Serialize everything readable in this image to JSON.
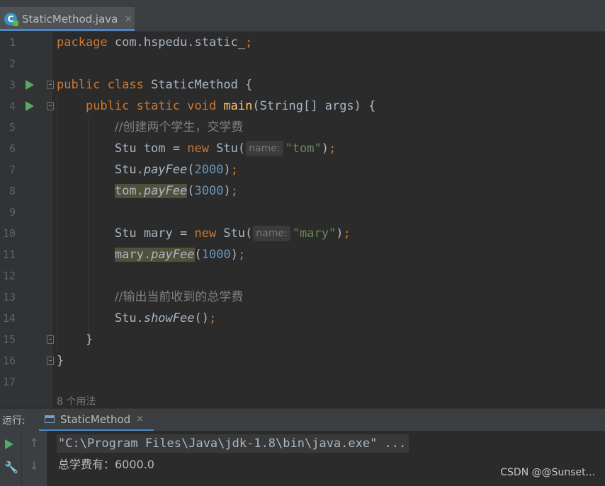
{
  "editor_tab": {
    "icon": "java-class-icon",
    "label": "StaticMethod.java",
    "close": "×"
  },
  "lines": [
    {
      "n": "1",
      "tokens": [
        [
          "kw",
          "package "
        ],
        [
          "plain",
          "com.hspedu.static_"
        ],
        [
          "kw",
          ";"
        ]
      ]
    },
    {
      "n": "2",
      "tokens": []
    },
    {
      "n": "3",
      "tokens": [
        [
          "kw",
          "public class "
        ],
        [
          "plain",
          "StaticMethod {"
        ]
      ]
    },
    {
      "n": "4",
      "tokens": [
        [
          "plain",
          "    "
        ],
        [
          "kw",
          "public static void "
        ],
        [
          "fn",
          "main"
        ],
        [
          "plain",
          "(String[] args) {"
        ]
      ]
    },
    {
      "n": "5",
      "tokens": [
        [
          "plain",
          "        "
        ],
        [
          "cmt",
          "//创建两个学生，交学费"
        ]
      ]
    },
    {
      "n": "6",
      "tokens": [
        [
          "plain",
          "        Stu tom = "
        ],
        [
          "kw",
          "new "
        ],
        [
          "plain",
          "Stu("
        ],
        [
          "hint",
          "name:"
        ],
        [
          "str",
          "\"tom\""
        ],
        [
          "plain",
          ")"
        ],
        [
          "kw",
          ";"
        ]
      ]
    },
    {
      "n": "7",
      "tokens": [
        [
          "plain",
          "        Stu."
        ],
        [
          "it",
          "payFee"
        ],
        [
          "plain",
          "("
        ],
        [
          "num",
          "2000"
        ],
        [
          "plain",
          ")"
        ],
        [
          "kw",
          ";"
        ]
      ]
    },
    {
      "n": "8",
      "tokens": [
        [
          "plain",
          "        "
        ],
        [
          "hl",
          "tom."
        ],
        [
          "hlit",
          "payFee"
        ],
        [
          "plain",
          "("
        ],
        [
          "num",
          "3000"
        ],
        [
          "plain",
          ")"
        ],
        [
          "kw",
          ";"
        ]
      ]
    },
    {
      "n": "9",
      "tokens": []
    },
    {
      "n": "10",
      "tokens": [
        [
          "plain",
          "        Stu mary = "
        ],
        [
          "kw",
          "new "
        ],
        [
          "plain",
          "Stu("
        ],
        [
          "hint",
          "name:"
        ],
        [
          "str",
          "\"mary\""
        ],
        [
          "plain",
          ")"
        ],
        [
          "kw",
          ";"
        ]
      ]
    },
    {
      "n": "11",
      "tokens": [
        [
          "plain",
          "        "
        ],
        [
          "hl",
          "mary."
        ],
        [
          "hlit",
          "payFee"
        ],
        [
          "plain",
          "("
        ],
        [
          "num",
          "1000"
        ],
        [
          "plain",
          ")"
        ],
        [
          "kw",
          ";"
        ]
      ]
    },
    {
      "n": "12",
      "tokens": []
    },
    {
      "n": "13",
      "tokens": [
        [
          "plain",
          "        "
        ],
        [
          "cmt",
          "//输出当前收到的总学费"
        ]
      ]
    },
    {
      "n": "14",
      "tokens": [
        [
          "plain",
          "        Stu."
        ],
        [
          "it",
          "showFee"
        ],
        [
          "plain",
          "()"
        ],
        [
          "kw",
          ";"
        ]
      ]
    },
    {
      "n": "15",
      "tokens": [
        [
          "plain",
          "    }"
        ]
      ]
    },
    {
      "n": "16",
      "tokens": [
        [
          "plain",
          "}"
        ]
      ]
    },
    {
      "n": "17",
      "tokens": []
    }
  ],
  "usages_hint": "8 个用法",
  "run_panel": {
    "label": "运行:",
    "tab_label": "StaticMethod",
    "tab_close": "×",
    "command": "\"C:\\Program Files\\Java\\jdk-1.8\\bin\\java.exe\" ...",
    "output": "总学费有：6000.0"
  },
  "watermark": "CSDN @@Sunset...",
  "colors": {
    "background": "#2b2b2b",
    "keyword": "#cc7832",
    "string": "#6a8759",
    "number": "#6897bb",
    "comment": "#808080",
    "method_decl": "#ffc66d",
    "accent": "#4a88c7",
    "run_green": "#59a869"
  }
}
